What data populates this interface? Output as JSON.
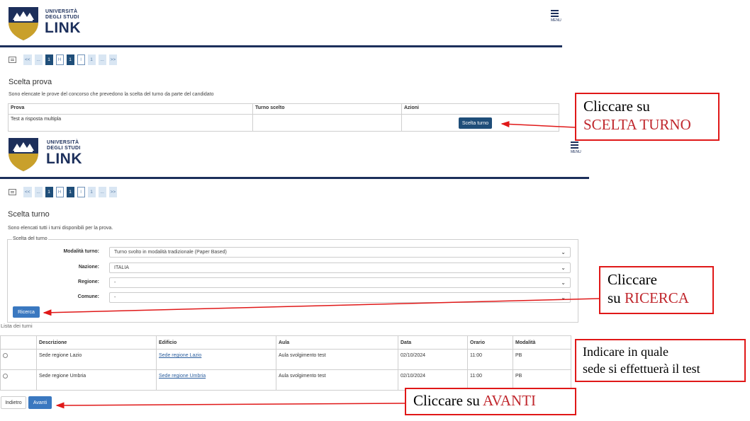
{
  "brand": {
    "line1": "UNIVERSITÀ",
    "line2": "DEGLI STUDI",
    "line3": "LINK",
    "menu_label": "MENU"
  },
  "colors": {
    "navy": "#1c2f5b",
    "gold": "#c9a02b",
    "button_dark": "#1f4e79",
    "button_blue": "#3a78c0",
    "callout_red": "#e01818"
  },
  "pagination": [
    "<<",
    "...",
    "1",
    "H",
    "1",
    "I",
    "1",
    "...",
    ">>"
  ],
  "screen1": {
    "title": "Scelta prova",
    "subtitle": "Sono elencate le prove del concorso che prevedono la scelta del turno da parte del candidato",
    "headers": [
      "Prova",
      "Turno scelto",
      "Azioni"
    ],
    "row": {
      "prova": "Test a risposta multipla",
      "turno": "",
      "button": "Scelta turno"
    }
  },
  "screen2": {
    "title": "Scelta turno",
    "subtitle": "Sono elencati tutti i turni disponibili per la prova.",
    "fieldset_legend": "Scelta del turno",
    "fields": [
      {
        "label": "Modalità turno:",
        "value": "Turno svolto in modalità tradizionale (Paper Based)"
      },
      {
        "label": "Nazione:",
        "value": "ITALIA"
      },
      {
        "label": "Regione:",
        "value": "-"
      },
      {
        "label": "Comune:",
        "value": "-"
      }
    ],
    "search_button": "Ricerca",
    "list_title": "Lista dei turni",
    "headers": [
      "Descrizione",
      "Edificio",
      "Aula",
      "Data",
      "Orario",
      "Modalità"
    ],
    "rows": [
      {
        "descrizione": "Sede regione Lazio",
        "edificio": "Sede regione Lazio",
        "aula": "Aula svolgimento test",
        "data": "02/10/2024",
        "orario": "11:00",
        "modalita": "PB"
      },
      {
        "descrizione": "Sede regione Umbria",
        "edificio": "Sede regione Umbria",
        "aula": "Aula svolgimento test",
        "data": "02/10/2024",
        "orario": "11:00",
        "modalita": "PB"
      }
    ],
    "back_button": "Indietro",
    "next_button": "Avanti"
  },
  "callouts": {
    "c1": {
      "line1": "Cliccare su",
      "line2": "SCELTA TURNO"
    },
    "c2": {
      "line1": "Cliccare",
      "line2_prefix": "su ",
      "line2_red": "RICERCA"
    },
    "c3": {
      "line1": "Indicare  in quale",
      "line2": "sede si effettuerà il test"
    },
    "c4": {
      "prefix": "Cliccare su ",
      "red": "AVANTI"
    }
  },
  "icons": [
    "shield-logo-icon",
    "menu-hamburger-icon",
    "list-view-icon",
    "select-chevron-icon",
    "radio-icon",
    "arrow-icon"
  ]
}
